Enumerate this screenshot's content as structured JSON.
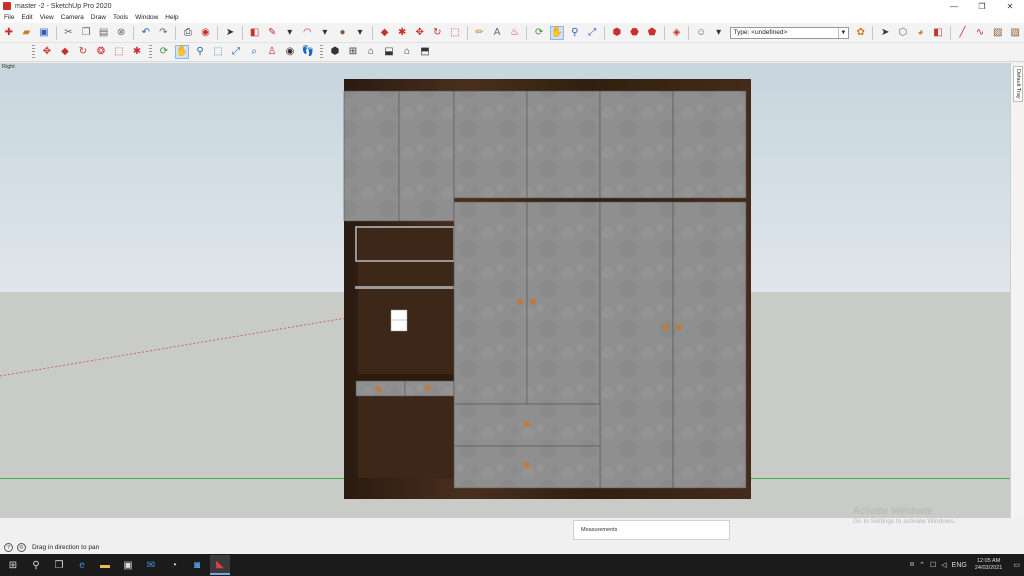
{
  "window": {
    "title": "master -2 - SketchUp Pro 2020",
    "controls": [
      "—",
      "❐",
      "✕"
    ]
  },
  "menu": [
    "File",
    "Edit",
    "View",
    "Camera",
    "Draw",
    "Tools",
    "Window",
    "Help"
  ],
  "toolbar": {
    "type_select": "Type: <undefined>"
  },
  "viewport": {
    "view_label": "Right"
  },
  "right_tray": {
    "tab_label": "Default Tray"
  },
  "measurements": {
    "label": "Measurements"
  },
  "watermark": {
    "title": "Activate Windows",
    "subtitle": "Go to Settings to activate Windows."
  },
  "status": {
    "text": "Drag in direction to pan"
  },
  "taskbar": {
    "language": "ENG",
    "time": "12:05 AM",
    "date": "24/03/2021"
  },
  "colors": {
    "sky": "#c7d5de",
    "ground": "#c9cbc6",
    "green_axis": "#3fae4b",
    "red_axis": "#d24a4a",
    "wood": "#3a2417",
    "panel": "#8f8f8f",
    "handle": "#c07a3e"
  }
}
